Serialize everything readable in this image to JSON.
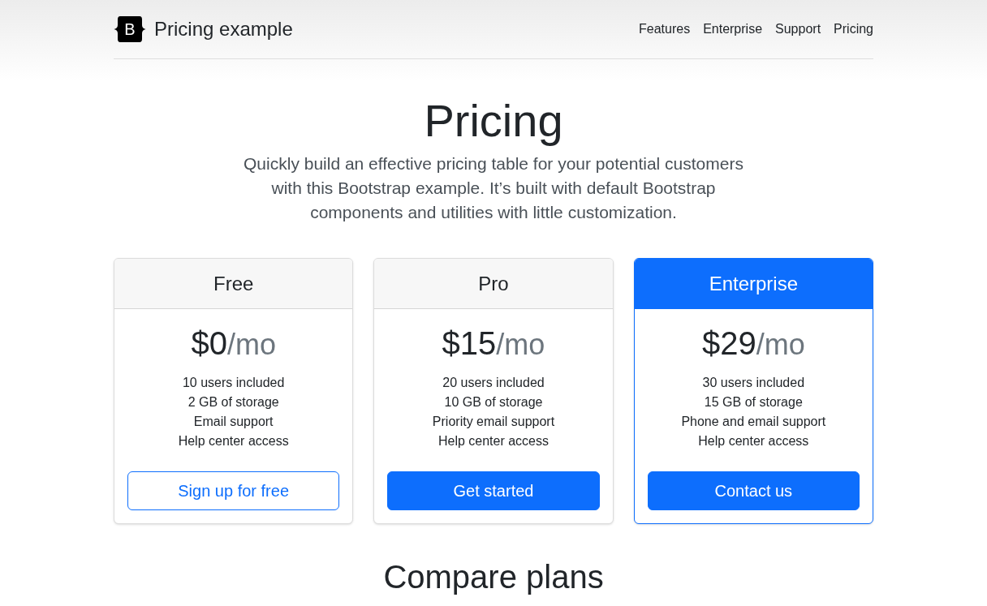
{
  "header": {
    "logo_letter": "B",
    "brand": "Pricing example",
    "nav": [
      "Features",
      "Enterprise",
      "Support",
      "Pricing"
    ]
  },
  "hero": {
    "title": "Pricing",
    "lead": "Quickly build an effective pricing table for your potential customers with this Bootstrap example. It’s built with default Bootstrap components and utilities with little customization."
  },
  "plans": [
    {
      "name": "Free",
      "featured": false,
      "price": "$0",
      "period": "/mo",
      "features": [
        "10 users included",
        "2 GB of storage",
        "Email support",
        "Help center access"
      ],
      "button": {
        "label": "Sign up for free",
        "kind": "outline"
      }
    },
    {
      "name": "Pro",
      "featured": false,
      "price": "$15",
      "period": "/mo",
      "features": [
        "20 users included",
        "10 GB of storage",
        "Priority email support",
        "Help center access"
      ],
      "button": {
        "label": "Get started",
        "kind": "solid"
      }
    },
    {
      "name": "Enterprise",
      "featured": true,
      "price": "$29",
      "period": "/mo",
      "features": [
        "30 users included",
        "15 GB of storage",
        "Phone and email support",
        "Help center access"
      ],
      "button": {
        "label": "Contact us",
        "kind": "solid"
      }
    }
  ],
  "compare": {
    "title": "Compare plans"
  }
}
